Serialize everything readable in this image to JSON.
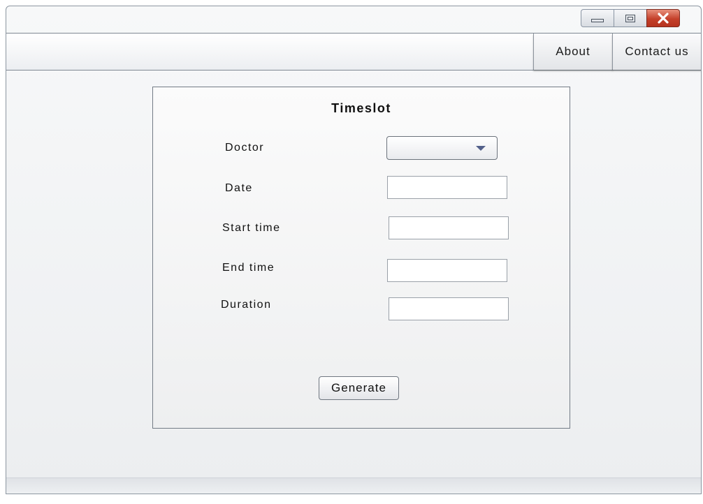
{
  "window": {
    "controls": {
      "minimize_icon": "minimize-icon",
      "maximize_icon": "maximize-icon",
      "close_icon": "close-icon",
      "close_color": "#c4402a"
    }
  },
  "menu": {
    "about_label": "About",
    "contact_label": "Contact us"
  },
  "form": {
    "title": "Timeslot",
    "doctor": {
      "label": "Doctor",
      "value": ""
    },
    "date": {
      "label": "Date",
      "value": ""
    },
    "start_time": {
      "label": "Start time",
      "value": ""
    },
    "end_time": {
      "label": "End time",
      "value": ""
    },
    "duration": {
      "label": "Duration",
      "value": ""
    },
    "generate_label": "Generate"
  },
  "colors": {
    "dropdown_arrow": "#52608a",
    "border": "#737b85"
  }
}
